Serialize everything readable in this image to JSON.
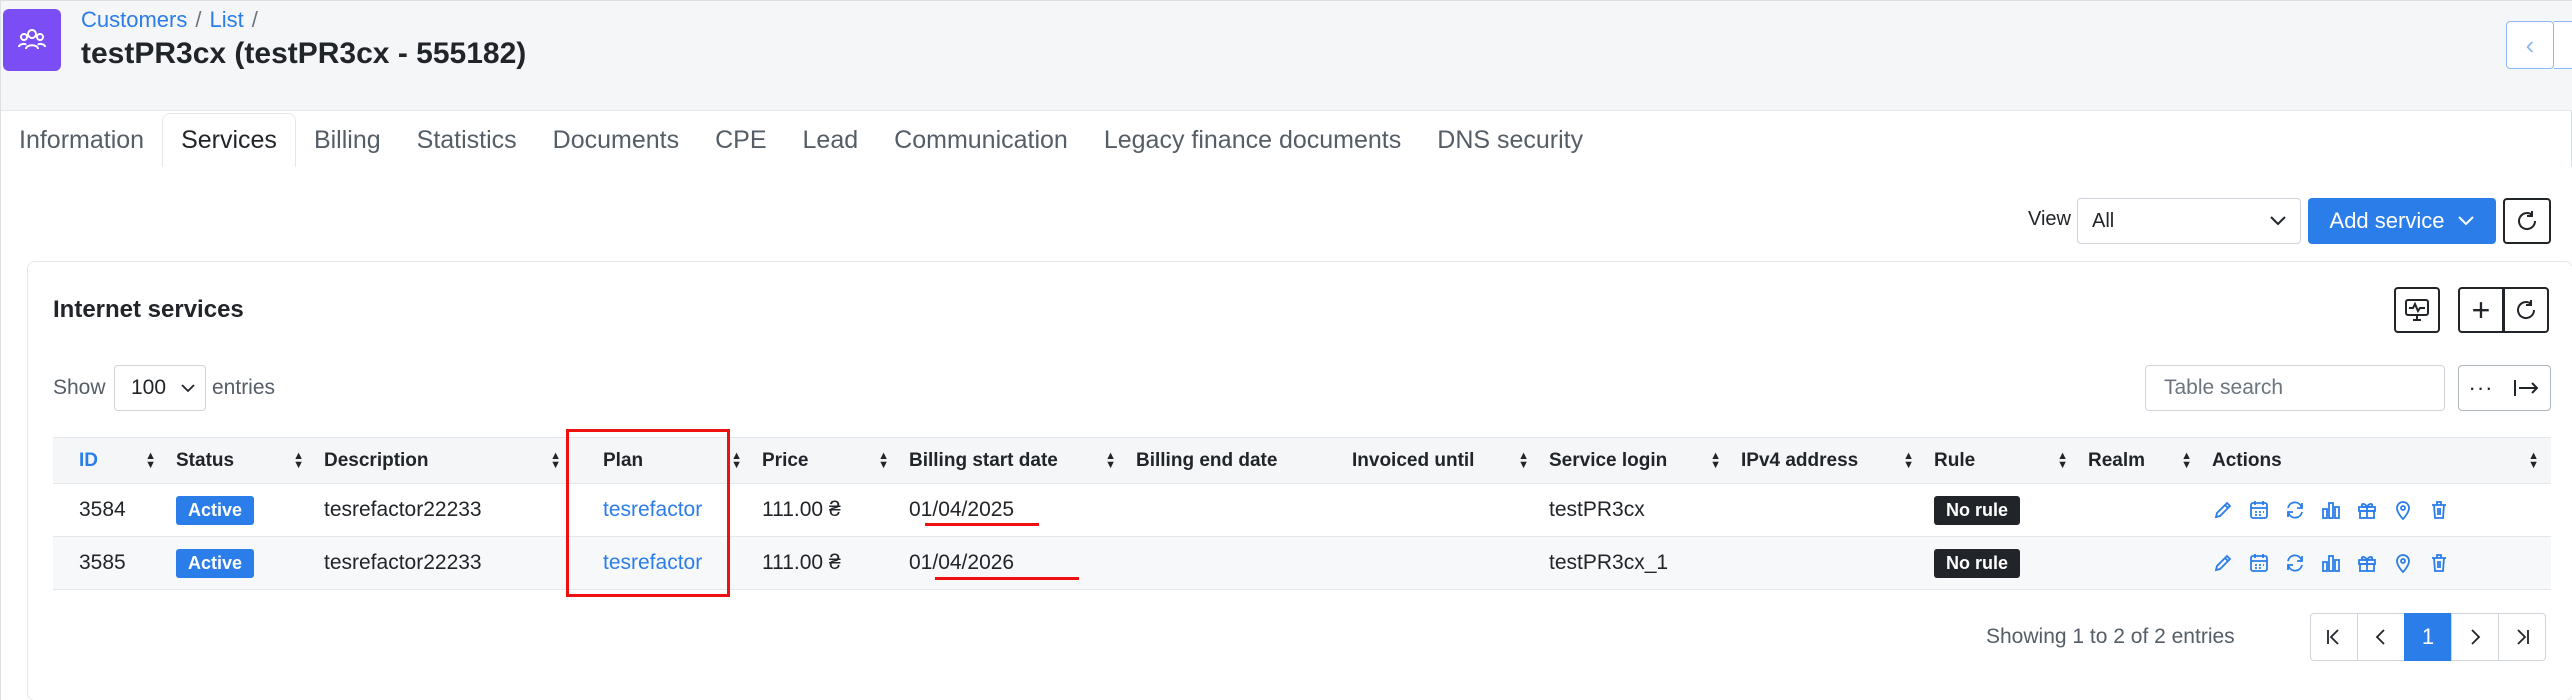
{
  "breadcrumb": {
    "item1": "Customers",
    "item2": "List"
  },
  "page_title": "testPR3cx (testPR3cx - 555182)",
  "tabs": [
    {
      "label": "Information"
    },
    {
      "label": "Services"
    },
    {
      "label": "Billing"
    },
    {
      "label": "Statistics"
    },
    {
      "label": "Documents"
    },
    {
      "label": "CPE"
    },
    {
      "label": "Lead"
    },
    {
      "label": "Communication"
    },
    {
      "label": "Legacy finance documents"
    },
    {
      "label": "DNS security"
    }
  ],
  "active_tab": "Services",
  "toolbar": {
    "view_label": "View",
    "view_value": "All",
    "add_service_label": "Add service"
  },
  "card": {
    "title": "Internet services"
  },
  "table_controls": {
    "show_label": "Show",
    "entries_value": "100",
    "entries_label": "entries",
    "search_placeholder": "Table search"
  },
  "table": {
    "columns": [
      "ID",
      "Status",
      "Description",
      "Plan",
      "Price",
      "Billing start date",
      "Billing end date",
      "Invoiced until",
      "Service login",
      "IPv4 address",
      "Rule",
      "Realm",
      "Actions"
    ],
    "rows": [
      {
        "id": "3584",
        "status": "Active",
        "description": "tesrefactor22233",
        "plan": "tesrefactor",
        "price": "111.00 ₴",
        "billing_start": "01/04/2025",
        "billing_end": "",
        "invoiced_until": "",
        "service_login": "testPR3cx",
        "ipv4": "",
        "rule": "No rule",
        "realm": ""
      },
      {
        "id": "3585",
        "status": "Active",
        "description": "tesrefactor22233",
        "plan": "tesrefactor",
        "price": "111.00 ₴",
        "billing_start": "01/04/2026",
        "billing_end": "",
        "invoiced_until": "",
        "service_login": "testPR3cx_1",
        "ipv4": "",
        "rule": "No rule",
        "realm": ""
      }
    ]
  },
  "footer": {
    "showing_text": "Showing 1 to 2 of 2 entries",
    "current_page": "1"
  },
  "colors": {
    "accent": "#2b7de9",
    "app_icon": "#7b4df5",
    "highlight": "#ee1111"
  },
  "icons": {
    "row_actions": [
      "pencil-icon",
      "calendar-icon",
      "sync-icon",
      "chart-icon",
      "gift-icon",
      "map-pin-icon",
      "trash-icon"
    ]
  }
}
